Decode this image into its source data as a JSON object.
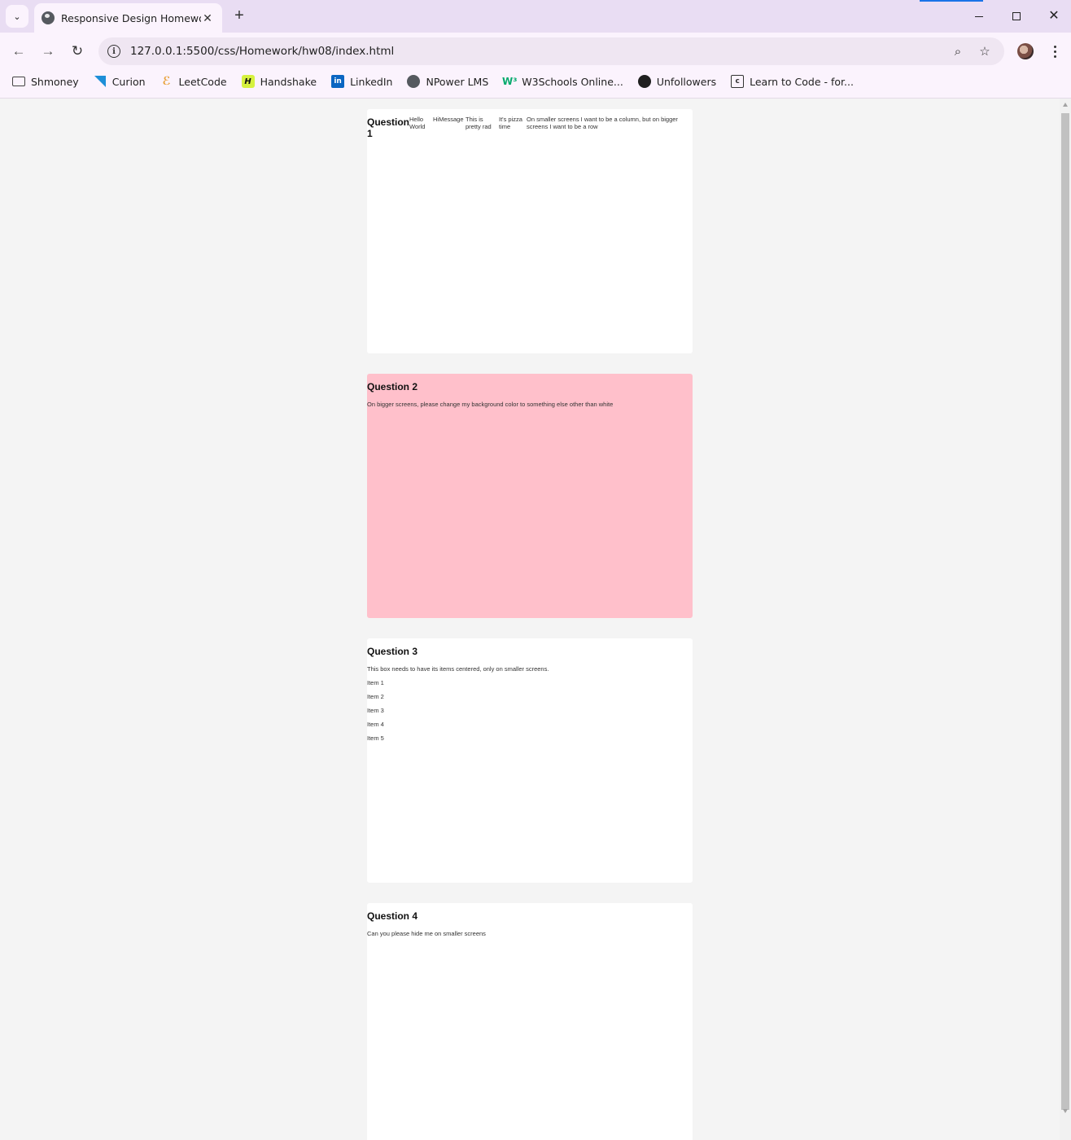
{
  "browser": {
    "tab_title": "Responsive Design Homework",
    "url": "127.0.0.1:5500/css/Homework/hw08/index.html",
    "bookmarks": [
      {
        "label": "Shmoney",
        "icon": "folder-icon"
      },
      {
        "label": "Curion",
        "icon": "curion-icon"
      },
      {
        "label": "LeetCode",
        "icon": "leetcode-icon"
      },
      {
        "label": "Handshake",
        "icon": "handshake-icon"
      },
      {
        "label": "LinkedIn",
        "icon": "linkedin-icon"
      },
      {
        "label": "NPower LMS",
        "icon": "globe-icon"
      },
      {
        "label": "W3Schools Online...",
        "icon": "w3schools-icon"
      },
      {
        "label": "Unfollowers",
        "icon": "github-icon"
      },
      {
        "label": "Learn to Code - for...",
        "icon": "code-icon"
      }
    ]
  },
  "page": {
    "q1": {
      "title": "Question 1",
      "items": [
        "Hello World",
        "Hi",
        "Message",
        "This is pretty rad",
        "It's pizza time",
        "On smaller screens I want to be a column, but on bigger screens I want to be a row"
      ]
    },
    "q2": {
      "title": "Question 2",
      "text": "On bigger screens, please change my background color to something else other than white",
      "background": "#ffc0cb"
    },
    "q3": {
      "title": "Question 3",
      "text": "This box needs to have its items centered, only on smaller screens.",
      "items": [
        "Item 1",
        "Item 2",
        "Item 3",
        "Item 4",
        "Item 5"
      ]
    },
    "q4": {
      "title": "Question 4",
      "text": "Can you please hide me on smaller screens"
    }
  }
}
